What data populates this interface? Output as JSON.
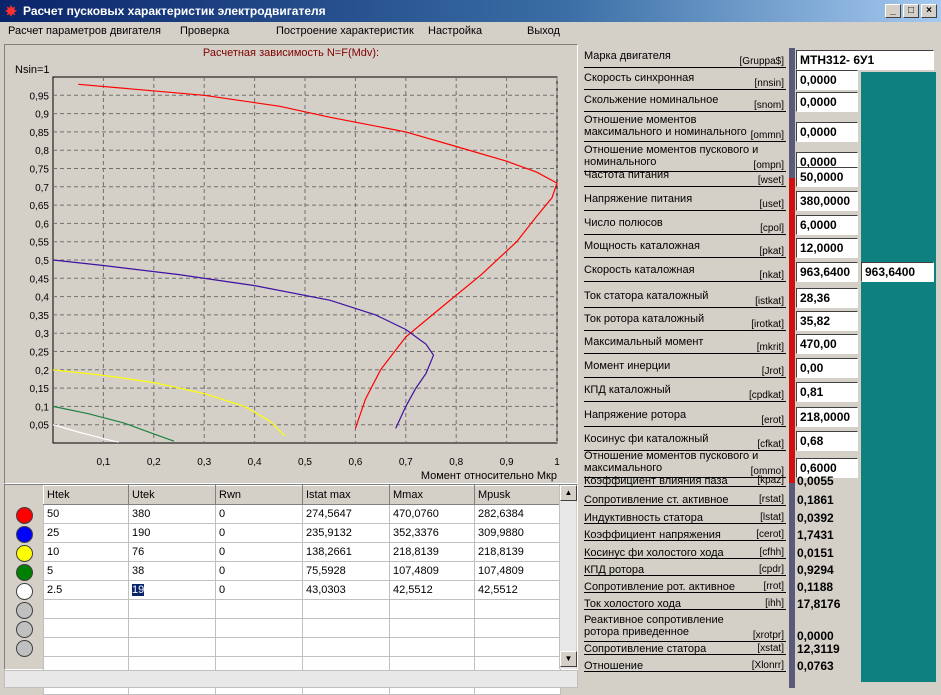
{
  "window": {
    "title": "Расчет пусковых характеристик электродвигателя"
  },
  "menu": [
    "Расчет параметров двигателя",
    "Проверка",
    "Построение характеристик",
    "Настройка",
    "Выход"
  ],
  "chart_data": {
    "type": "line",
    "title": "Расчетная зависимость N=F(Mdv):",
    "ylabel": "Nsin=1",
    "xlabel": "Момент относительно Мкр",
    "xlim": [
      0,
      1
    ],
    "ylim": [
      0,
      1
    ],
    "x_ticks": [
      "0,1",
      "0,2",
      "0,3",
      "0,4",
      "0,5",
      "0,6",
      "0,7",
      "0,8",
      "0,9",
      "1"
    ],
    "y_ticks": [
      "0,05",
      "0,1",
      "0,15",
      "0,2",
      "0,25",
      "0,3",
      "0,35",
      "0,4",
      "0,45",
      "0,5",
      "0,55",
      "0,6",
      "0,65",
      "0,7",
      "0,75",
      "0,8",
      "0,85",
      "0,9",
      "0,95"
    ],
    "grid": true,
    "series": [
      {
        "color": "#ff0000",
        "points": [
          [
            0.05,
            0.98
          ],
          [
            0.3,
            0.95
          ],
          [
            0.45,
            0.92
          ],
          [
            0.55,
            0.89
          ],
          [
            0.7,
            0.85
          ],
          [
            0.8,
            0.81
          ],
          [
            0.9,
            0.77
          ],
          [
            0.96,
            0.74
          ],
          [
            1.0,
            0.71
          ],
          [
            0.99,
            0.67
          ],
          [
            0.96,
            0.62
          ],
          [
            0.92,
            0.55
          ],
          [
            0.85,
            0.46
          ],
          [
            0.77,
            0.37
          ],
          [
            0.7,
            0.29
          ],
          [
            0.65,
            0.2
          ],
          [
            0.62,
            0.12
          ],
          [
            0.6,
            0.04
          ]
        ]
      },
      {
        "color": "#4010a0",
        "points": [
          [
            0.0,
            0.5
          ],
          [
            0.1,
            0.485
          ],
          [
            0.25,
            0.46
          ],
          [
            0.4,
            0.43
          ],
          [
            0.55,
            0.39
          ],
          [
            0.64,
            0.35
          ],
          [
            0.7,
            0.31
          ],
          [
            0.74,
            0.27
          ],
          [
            0.755,
            0.24
          ],
          [
            0.74,
            0.19
          ],
          [
            0.72,
            0.15
          ],
          [
            0.7,
            0.1
          ],
          [
            0.68,
            0.04
          ]
        ]
      },
      {
        "color": "#ffff00",
        "points": [
          [
            0.0,
            0.2
          ],
          [
            0.1,
            0.185
          ],
          [
            0.2,
            0.165
          ],
          [
            0.3,
            0.135
          ],
          [
            0.38,
            0.1
          ],
          [
            0.43,
            0.06
          ],
          [
            0.46,
            0.02
          ]
        ]
      },
      {
        "color": "#208040",
        "points": [
          [
            0.0,
            0.1
          ],
          [
            0.07,
            0.08
          ],
          [
            0.14,
            0.055
          ],
          [
            0.2,
            0.025
          ],
          [
            0.24,
            0.005
          ]
        ]
      },
      {
        "color": "#ffffff",
        "points": [
          [
            0.0,
            0.05
          ],
          [
            0.05,
            0.03
          ],
          [
            0.1,
            0.012
          ],
          [
            0.13,
            0.002
          ]
        ]
      }
    ]
  },
  "table": {
    "headers": [
      "Htek",
      "Utek",
      "Rwn",
      "Istat max",
      "Mmax",
      "Mpusk"
    ],
    "rows": [
      {
        "color": "#ff0000",
        "cells": [
          "50",
          "380",
          "0",
          "274,5647",
          "470,0760",
          "282,6384"
        ]
      },
      {
        "color": "#0000ff",
        "cells": [
          "25",
          "190",
          "0",
          "235,9132",
          "352,3376",
          "309,9880"
        ]
      },
      {
        "color": "#ffff00",
        "cells": [
          "10",
          "76",
          "0",
          "138,2661",
          "218,8139",
          "218,8139"
        ]
      },
      {
        "color": "#008000",
        "cells": [
          "5",
          "38",
          "0",
          "75,5928",
          "107,4809",
          "107,4809"
        ]
      },
      {
        "color": "#ffffff",
        "cells": [
          "2.5",
          "19",
          "0",
          "43,0303",
          "42,5512",
          "42,5512"
        ]
      },
      {
        "color": "#c0c0c0",
        "cells": [
          "",
          "",
          "",
          "",
          "",
          ""
        ]
      },
      {
        "color": "#c0c0c0",
        "cells": [
          "",
          "",
          "",
          "",
          "",
          ""
        ]
      },
      {
        "color": "#c0c0c0",
        "cells": [
          "",
          "",
          "",
          "",
          "",
          ""
        ]
      }
    ]
  },
  "params": [
    {
      "name": "Марка двигателя",
      "code": "[Gruppa$]",
      "value": "МТН312- 6У1"
    },
    {
      "name": "Скорость синхронная",
      "code": "[nnsin]",
      "value": "0,0000"
    },
    {
      "name": "Скольжение номинальное",
      "code": "[snom]",
      "value": "0,0000"
    },
    {
      "name": "Отношение моментов максимального и номинального",
      "code": "[ommn]",
      "value": "0,0000"
    },
    {
      "name": "Отношение моментов пускового и номинального",
      "code": "[ompn]",
      "value": "0,0000"
    },
    {
      "name": "Частота питания",
      "code": "[wset]",
      "value": "50,0000"
    },
    {
      "name": "Напряжение питания",
      "code": "[uset]",
      "value": "380,0000"
    },
    {
      "name": "Число полюсов",
      "code": "[cpol]",
      "value": "6,0000"
    },
    {
      "name": "Мощность каталожная",
      "code": "[pkat]",
      "value": "12,0000"
    },
    {
      "name": "Скорость каталожная",
      "code": "[nkat]",
      "value": "963,6400",
      "extra": "963,6400"
    },
    {
      "name": "Ток статора каталожный",
      "code": "[istkat]",
      "value": "28,36"
    },
    {
      "name": "Ток ротора каталожный",
      "code": "[irotkat]",
      "value": "35,82"
    },
    {
      "name": "Максимальный момент",
      "code": "[mkrit]",
      "value": "470,00"
    },
    {
      "name": "Момент инерции",
      "code": "[Jrot]",
      "value": "0,00"
    },
    {
      "name": "КПД каталожный",
      "code": "[cpdkat]",
      "value": "0,81"
    },
    {
      "name": "Напряжение ротора",
      "code": "[erot]",
      "value": "218,0000"
    },
    {
      "name": "Косинус фи каталожный",
      "code": "[cfkat]",
      "value": "0,68"
    },
    {
      "name": "Отношение моментов пускового и максимального",
      "code": "[ommo]",
      "value": "0,6000"
    },
    {
      "name": "Коэффициент влияния паза",
      "code": "[kpaz]",
      "value": "0,0055"
    },
    {
      "name": "Сопротивление ст. активное",
      "code": "[rstat]",
      "value": "0,1861"
    },
    {
      "name": "Индуктивность статора",
      "code": "[lstat]",
      "value": "0,0392"
    },
    {
      "name": "Коэффициент напряжения",
      "code": "[cerot]",
      "value": "1,7431"
    },
    {
      "name": "Косинус фи холостого хода",
      "code": "[cfhh]",
      "value": "0,0151"
    },
    {
      "name": "КПД ротора",
      "code": "[cpdr]",
      "value": "0,9294"
    },
    {
      "name": "Сопротивление рот. активное",
      "code": "[rrot]",
      "value": "0,1188"
    },
    {
      "name": "Ток холостого хода",
      "code": "[ihh]",
      "value": "17,8176"
    },
    {
      "name": "Реактивное сопротивление ротора приведенное",
      "code": "[xrotpr]",
      "value": "0,0000"
    },
    {
      "name": "Сопротивление статора",
      "code": "[xstat]",
      "value": "12,3119"
    },
    {
      "name": "Отношение",
      "code": "[Xlonrr]",
      "value": "0,0763"
    }
  ]
}
